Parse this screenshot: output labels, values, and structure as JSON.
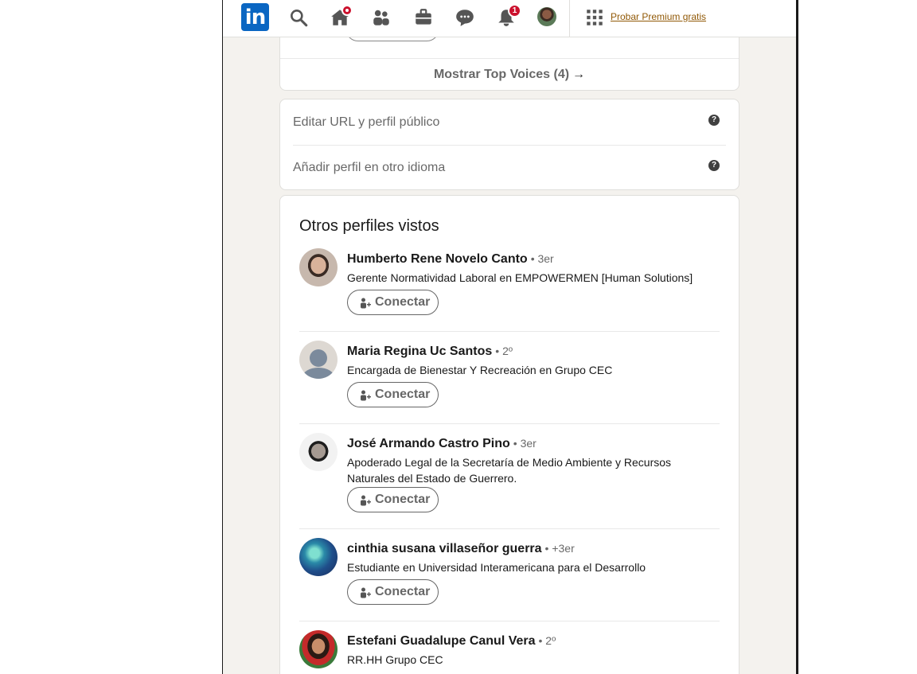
{
  "nav": {
    "logo_text": "in",
    "icons": [
      "search-icon",
      "home-icon",
      "my-network-icon",
      "jobs-icon",
      "messaging-icon",
      "notifications-icon",
      "avatar",
      "apps-grid-icon"
    ],
    "notifications_badge": "1",
    "premium_link": "Probar Premium gratis",
    "accent_color": "#0a66c2",
    "badge_color": "#cb112d"
  },
  "top_voices": {
    "link_label": "Mostrar Top Voices (4)",
    "arrow": "→"
  },
  "profile_links": {
    "items": [
      {
        "label": "Editar URL y perfil público",
        "help_icon": "?"
      },
      {
        "label": "Añadir perfil en otro idioma",
        "help_icon": "?"
      }
    ]
  },
  "others_viewed": {
    "title": "Otros perfiles vistos",
    "connect_label": "Conectar",
    "people": [
      {
        "name": "Humberto Rene Novelo Canto",
        "degree": "• 3er",
        "headline": "Gerente Normatividad Laboral en EMPOWERMEN [Human Solutions]"
      },
      {
        "name": "Maria Regina Uc Santos",
        "degree": "• 2º",
        "headline": "Encargada de Bienestar Y Recreación en Grupo CEC"
      },
      {
        "name": "José Armando Castro Pino",
        "degree": "• 3er",
        "headline": "Apoderado Legal de la Secretaría de Medio Ambiente y Recursos Naturales del Estado de Guerrero."
      },
      {
        "name": "cinthia susana villaseñor guerra",
        "degree": "• +3er",
        "headline": "Estudiante en Universidad Interamericana para el Desarrollo"
      },
      {
        "name": "Estefani Guadalupe Canul Vera",
        "degree": "• 2º",
        "headline": "RR.HH Grupo CEC"
      }
    ]
  }
}
